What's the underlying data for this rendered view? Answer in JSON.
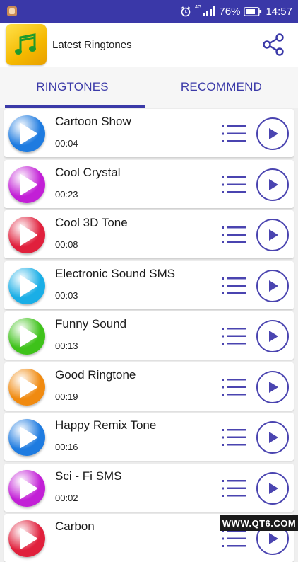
{
  "status_bar": {
    "network": "4G",
    "battery_percent": "76%",
    "time": "14:57"
  },
  "app": {
    "title": "Latest Ringtones"
  },
  "tabs": [
    {
      "label": "RINGTONES",
      "selected": true
    },
    {
      "label": "RECOMMEND",
      "selected": false
    }
  ],
  "ringtones": [
    {
      "title": "Cartoon Show",
      "duration": "00:04",
      "color": "#1e7be0"
    },
    {
      "title": "Cool Crystal",
      "duration": "00:23",
      "color": "#c21fd6"
    },
    {
      "title": "Cool 3D Tone",
      "duration": "00:08",
      "color": "#e0203c"
    },
    {
      "title": "Electronic Sound SMS",
      "duration": "00:03",
      "color": "#1aaee6"
    },
    {
      "title": "Funny Sound",
      "duration": "00:13",
      "color": "#3ec21a"
    },
    {
      "title": "Good Ringtone",
      "duration": "00:19",
      "color": "#f08a10"
    },
    {
      "title": "Happy Remix Tone",
      "duration": "00:16",
      "color": "#1e7be0"
    },
    {
      "title": "Sci - Fi SMS",
      "duration": "00:02",
      "color": "#c21fd6"
    },
    {
      "title": "Carbon",
      "duration": "",
      "color": "#e0203c"
    }
  ],
  "colors": {
    "accent": "#3b3aa8",
    "status_bar": "#3a38a8"
  },
  "watermark": "WWW.QT6.COM"
}
